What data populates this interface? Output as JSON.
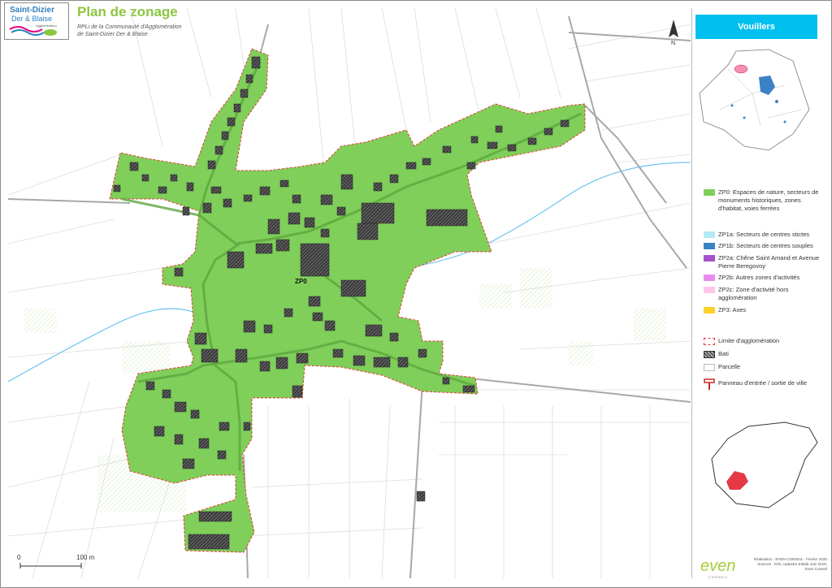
{
  "header": {
    "logo": {
      "line1": "Saint-Dizier",
      "line2": "Der & Blaise",
      "line3": "Agglomération"
    },
    "title": "Plan de zonage",
    "subtitle_line1": "RPLi de la Communauté d'Agglomération",
    "subtitle_line2": "de Saint-Dizier Der & Blaise"
  },
  "map": {
    "zone_label": "ZP0",
    "north_label": "N",
    "scale": {
      "start": "0",
      "end": "100 m"
    }
  },
  "panel": {
    "commune": "Vouillers",
    "commune_banner_color": "#00c0ef",
    "legend": [
      {
        "label": "ZP0: Espaces de nature, secteurs de monuments historiques, zones d'habitat, voies ferrées",
        "color": "#7fcf5a"
      },
      {
        "label": "ZP1a: Secteurs de centres stictes",
        "color": "#b4e8f5"
      },
      {
        "label": "ZP1b: Secteurs de centres souples",
        "color": "#3a82c4"
      },
      {
        "label": "ZP2a: Chêne Saint Amand et Avenue Pierre Beregovoy",
        "color": "#a552c9"
      },
      {
        "label": "ZP2b: Autres zones d'activités",
        "color": "#ea8cef"
      },
      {
        "label": "ZP2c: Zone d'activité hors agglomération",
        "color": "#fbc7e8"
      },
      {
        "label": "ZP3: Axes",
        "color": "#fcd12a"
      },
      {
        "label": "Limite d'agglomération",
        "color": "#e53935"
      },
      {
        "label": "Bati",
        "color": "#555555"
      },
      {
        "label": "Parcelle",
        "color": "#cccccc"
      },
      {
        "label": "Panneau d'entrée / sortie de ville",
        "color": "#c62828"
      }
    ],
    "credits": {
      "line1": "Réalisation : EVEN CONSEIL - Février 2020",
      "line2": "Sources : IGN, cadastre Etalab Juin 2019,",
      "line3": "Even Conseil"
    },
    "even_logo": "even",
    "even_sub": "CONSEIL"
  }
}
